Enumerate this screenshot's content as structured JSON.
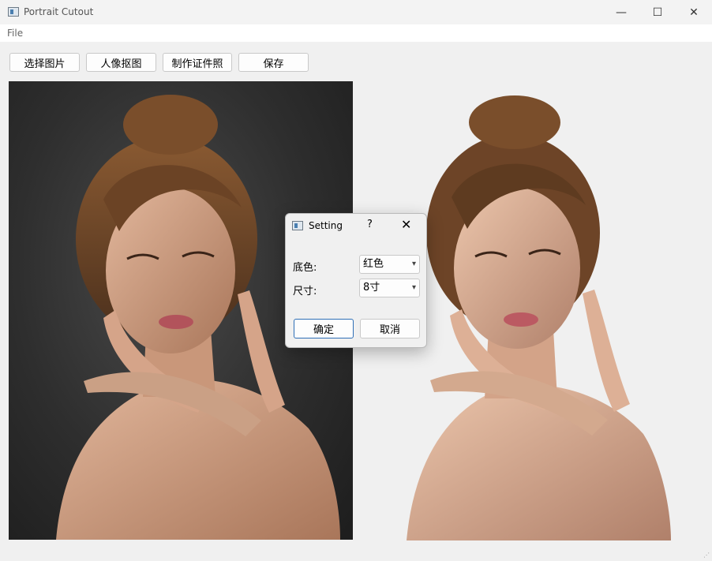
{
  "window": {
    "title": "Portrait Cutout",
    "icon": "app-icon"
  },
  "window_controls": {
    "minimize": "—",
    "maximize": "☐",
    "close": "✕"
  },
  "menu": {
    "file": "File"
  },
  "toolbar": {
    "select_image": "选择图片",
    "portrait_cutout": "人像抠图",
    "make_id_photo": "制作证件照",
    "save": "保存"
  },
  "dialog": {
    "title": "Setting",
    "help": "?",
    "close": "✕",
    "bg_color_label": "底色:",
    "bg_color_value": "红色",
    "size_label": "尺寸:",
    "size_value": "8寸",
    "ok": "确定",
    "cancel": "取消"
  },
  "colors": {
    "accent": "#2f6fb6",
    "background": "#f0f0f0",
    "photo_bg": "#2e2e2e"
  }
}
